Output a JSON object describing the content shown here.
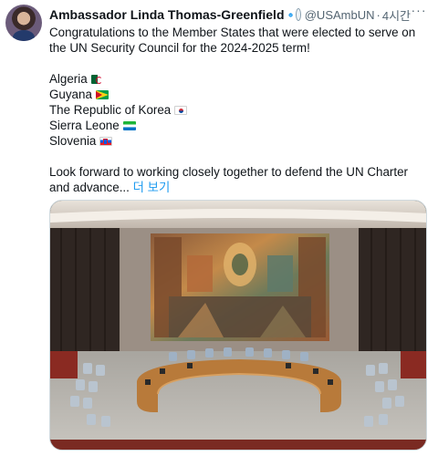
{
  "tweet": {
    "author_name": "Ambassador Linda Thomas-Greenfield",
    "handle": "@USAmbUN",
    "separator": "·",
    "time": "4시간",
    "more_label": "···",
    "text_intro": "Congratulations to the Member States that were elected to serve on the UN Security Council for the 2024-2025 term!",
    "countries": [
      "Algeria",
      "Guyana",
      "The Republic of Korea",
      "Sierra Leone",
      "Slovenia"
    ],
    "text_outro": "Look forward to working closely together to defend the UN Charter and advance...",
    "show_more": "더 보기"
  },
  "icons": {
    "verified": "verified-badge-icon",
    "government": "government-affiliation-icon",
    "more": "more-options-icon"
  },
  "colors": {
    "link": "#1d9bf0",
    "verified": "#1d9bf0",
    "secondary_text": "#536471"
  }
}
